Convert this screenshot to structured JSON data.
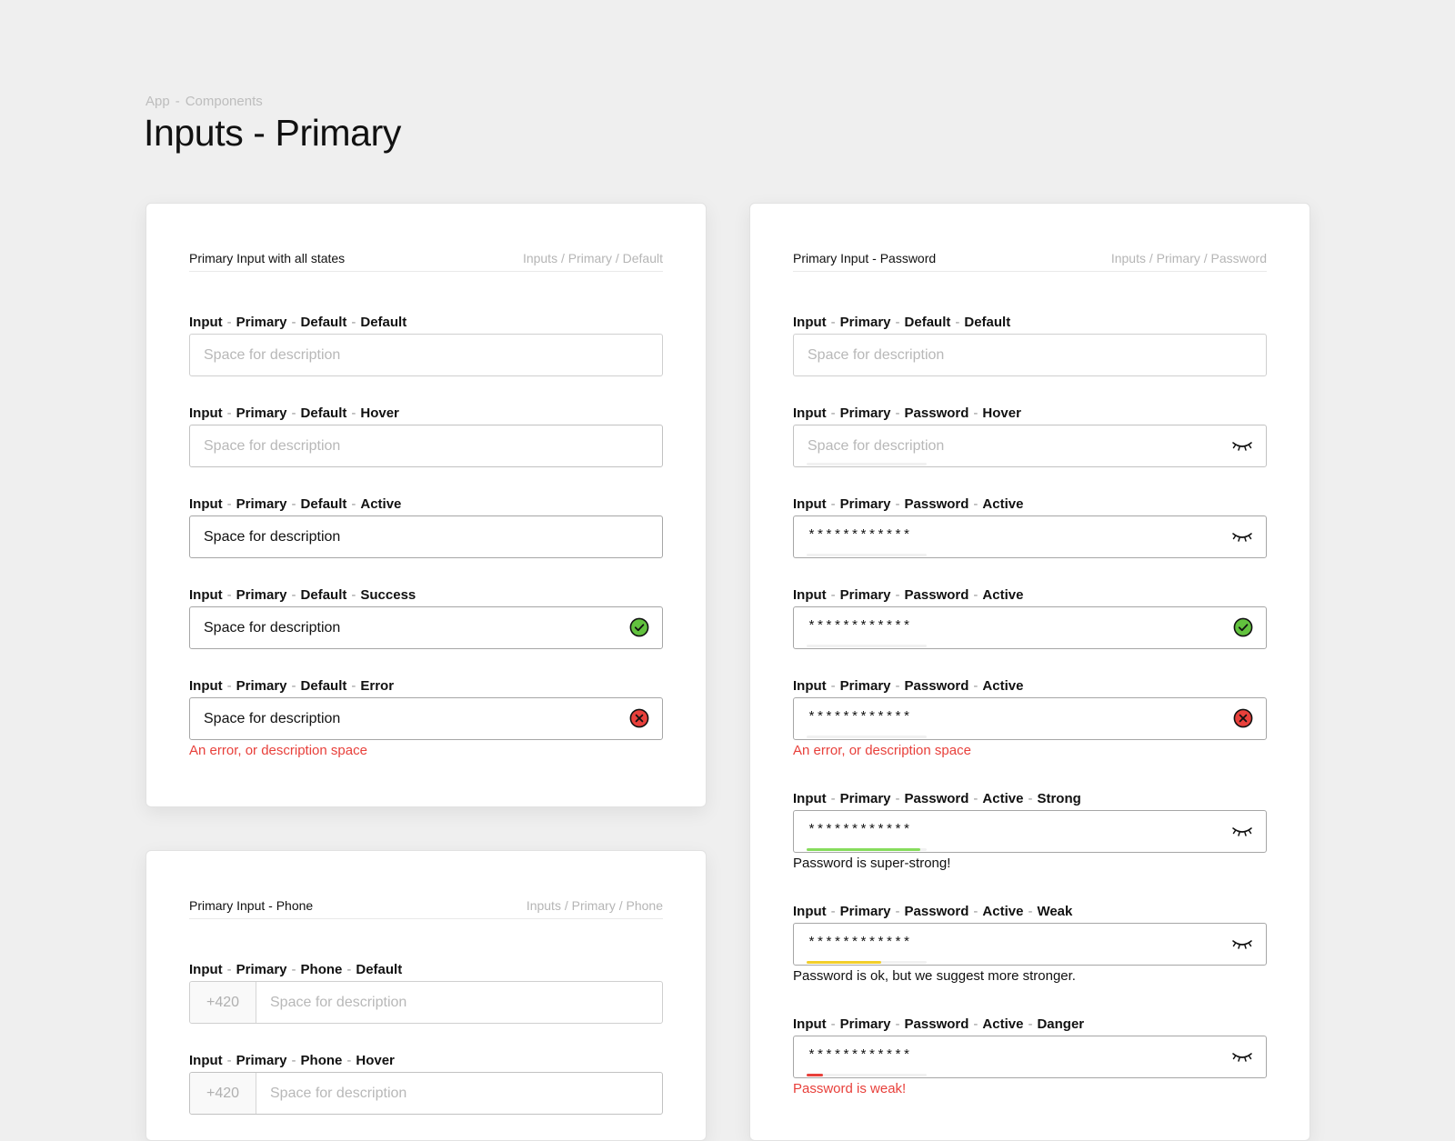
{
  "breadcrumb": {
    "app": "App",
    "separator": "-",
    "section": "Components"
  },
  "page_title": "Inputs - Primary",
  "colors": {
    "success": "#62c23e",
    "error": "#e8403b",
    "strong": "#86dc5c",
    "weak": "#f2cf2a",
    "danger": "#e8403b"
  },
  "default_card": {
    "title": "Primary Input with all states",
    "path": "Inputs / Primary / Default",
    "fields": [
      {
        "label": [
          "Input",
          "Primary",
          "Default",
          "Default"
        ],
        "placeholder": "Space for description"
      },
      {
        "label": [
          "Input",
          "Primary",
          "Default",
          "Hover"
        ],
        "placeholder": "Space for description"
      },
      {
        "label": [
          "Input",
          "Primary",
          "Default",
          "Active"
        ],
        "value": "Space for description"
      },
      {
        "label": [
          "Input",
          "Primary",
          "Default",
          "Success"
        ],
        "value": "Space for description",
        "icon": "check-circle-icon"
      },
      {
        "label": [
          "Input",
          "Primary",
          "Default",
          "Error"
        ],
        "value": "Space for description",
        "icon": "x-circle-icon",
        "helper": "An error, or description space"
      }
    ]
  },
  "phone_card": {
    "title": "Primary Input - Phone",
    "path": "Inputs / Primary / Phone",
    "fields": [
      {
        "label": [
          "Input",
          "Primary",
          "Phone",
          "Default"
        ],
        "prefix": "+420",
        "placeholder": "Space for description"
      },
      {
        "label": [
          "Input",
          "Primary",
          "Phone",
          "Hover"
        ],
        "prefix": "+420",
        "placeholder": "Space for description"
      }
    ]
  },
  "password_card": {
    "title": "Primary Input - Password",
    "path": "Inputs / Primary / Password",
    "fields": [
      {
        "label": [
          "Input",
          "Primary",
          "Default",
          "Default"
        ],
        "placeholder": "Space for description"
      },
      {
        "label": [
          "Input",
          "Primary",
          "Password",
          "Hover"
        ],
        "placeholder": "Space for description",
        "icon": "eye-closed-icon",
        "strength": 0
      },
      {
        "label": [
          "Input",
          "Primary",
          "Password",
          "Active"
        ],
        "value": "************",
        "icon": "eye-closed-icon",
        "strength": 0
      },
      {
        "label": [
          "Input",
          "Primary",
          "Password",
          "Active"
        ],
        "value": "************",
        "icon": "check-circle-icon",
        "strength": 0
      },
      {
        "label": [
          "Input",
          "Primary",
          "Password",
          "Active"
        ],
        "value": "************",
        "icon": "x-circle-icon",
        "strength": 0,
        "helper": "An error, or description space"
      },
      {
        "label": [
          "Input",
          "Primary",
          "Password",
          "Active",
          "Strong"
        ],
        "value": "************",
        "icon": "eye-closed-icon",
        "strength": 0.95,
        "helper": "Password is super-strong!"
      },
      {
        "label": [
          "Input",
          "Primary",
          "Password",
          "Active",
          "Weak"
        ],
        "value": "************",
        "icon": "eye-closed-icon",
        "strength": 0.62,
        "helper": "Password is ok, but we suggest more stronger."
      },
      {
        "label": [
          "Input",
          "Primary",
          "Password",
          "Active",
          "Danger"
        ],
        "value": "************",
        "icon": "eye-closed-icon",
        "strength": 0.14,
        "helper": "Password is weak!"
      }
    ]
  }
}
